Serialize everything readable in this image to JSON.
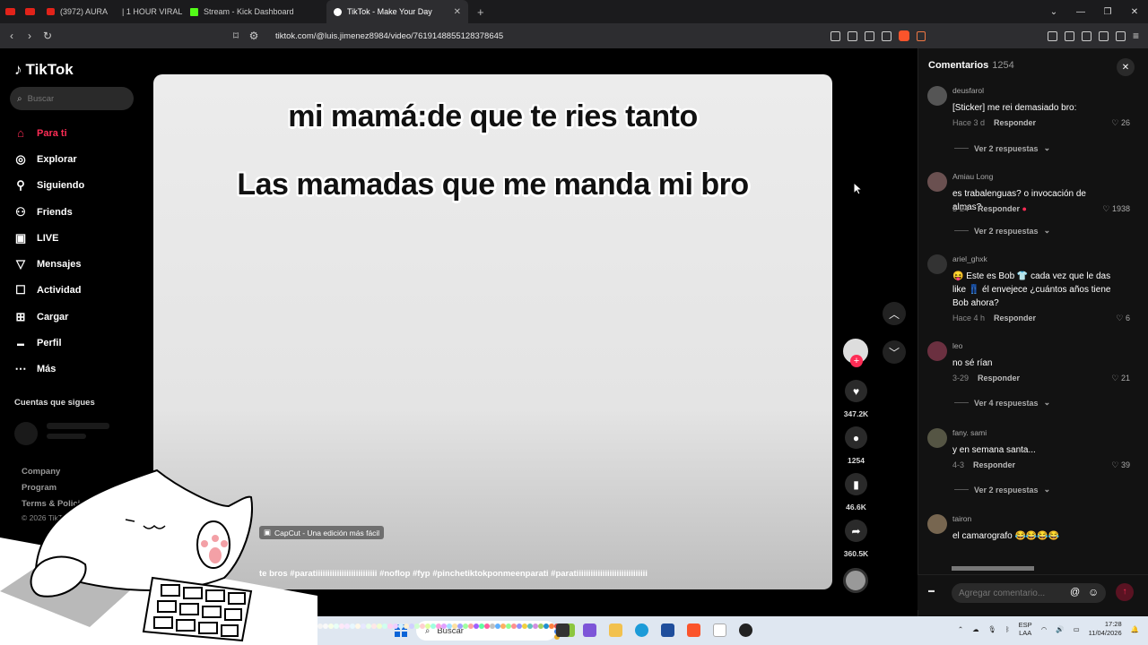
{
  "browser": {
    "tabs": [
      {
        "label": "(3972) AURA"
      },
      {
        "label": "| 1 HOUR VIRAL A"
      },
      {
        "label": "Stream - Kick Dashboard"
      },
      {
        "label": "TikTok - Make Your Day"
      }
    ],
    "url": "tiktok.com/@luis.jimenez8984/video/7619148855128378645"
  },
  "sidebar": {
    "logo": "TikTok",
    "search_placeholder": "Buscar",
    "items": [
      {
        "label": "Para ti",
        "icon": "home-icon"
      },
      {
        "label": "Explorar",
        "icon": "compass-icon"
      },
      {
        "label": "Siguiendo",
        "icon": "following-icon"
      },
      {
        "label": "Friends",
        "icon": "friends-icon"
      },
      {
        "label": "LIVE",
        "icon": "live-icon"
      },
      {
        "label": "Mensajes",
        "icon": "messages-icon"
      },
      {
        "label": "Actividad",
        "icon": "activity-icon"
      },
      {
        "label": "Cargar",
        "icon": "upload-icon"
      },
      {
        "label": "Perfil",
        "icon": "profile-icon"
      },
      {
        "label": "Más",
        "icon": "more-icon"
      }
    ],
    "following_title": "Cuentas que sigues",
    "footer": [
      "Company",
      "Program",
      "Terms & Policies"
    ],
    "copyright": "© 2026 TikTok"
  },
  "video": {
    "caption_line1": "mi mamá:de que te ries tanto",
    "caption_line2": "Las mamadas que me manda mi bro",
    "capcut_label": "CapCut - Una edición más fácil",
    "description": "te bros #paratiiiiiiiiiiiiiiiiiiiiiiiiii #noflop #fyp #pinchetiktokponmeenparati #paratiiiiiiiiiiiiiiiiiiiiiiiiiiiiii"
  },
  "actions": {
    "likes": "347.2K",
    "comments": "1254",
    "saves": "46.6K",
    "shares": "360.5K"
  },
  "comments": {
    "title": "Comentarios",
    "count": "1254",
    "reply_label": "Responder",
    "items": [
      {
        "user": "deusfarol",
        "text": "[Sticker] me rei demasiado bro:",
        "time": "Hace 3 d",
        "likes": "26",
        "more": "Ver 2 respuestas"
      },
      {
        "user": "Amiau Long",
        "text": "es trabalenguas? o invocación de almas?",
        "time": "3-24",
        "likes": "1938",
        "more": "Ver 2 respuestas"
      },
      {
        "user": "ariel_ghxk",
        "text": "😝 Este es Bob 👕 cada vez que le das like 👖 él envejece ¿cuántos años tiene Bob ahora?",
        "time": "Hace 4 h",
        "likes": "6",
        "more": ""
      },
      {
        "user": "leo",
        "text": "no sé rían",
        "time": "3-29",
        "likes": "21",
        "more": "Ver 4 respuestas"
      },
      {
        "user": "fany. sami",
        "text": "y en semana santa...",
        "time": "4-3",
        "likes": "39",
        "more": "Ver 2 respuestas"
      },
      {
        "user": "tairon",
        "text": "el camarografo 😂😂😂😂",
        "time": "",
        "likes": "",
        "more": ""
      }
    ],
    "input_placeholder": "Agregar comentario..."
  },
  "taskbar": {
    "search_label": "Buscar",
    "lang_top": "ESP",
    "lang_bottom": "LAA",
    "time": "17:28",
    "date": "11/04/2026"
  },
  "colors": {
    "accent": "#fe2c55",
    "background": "#000000",
    "panel": "#121212"
  }
}
